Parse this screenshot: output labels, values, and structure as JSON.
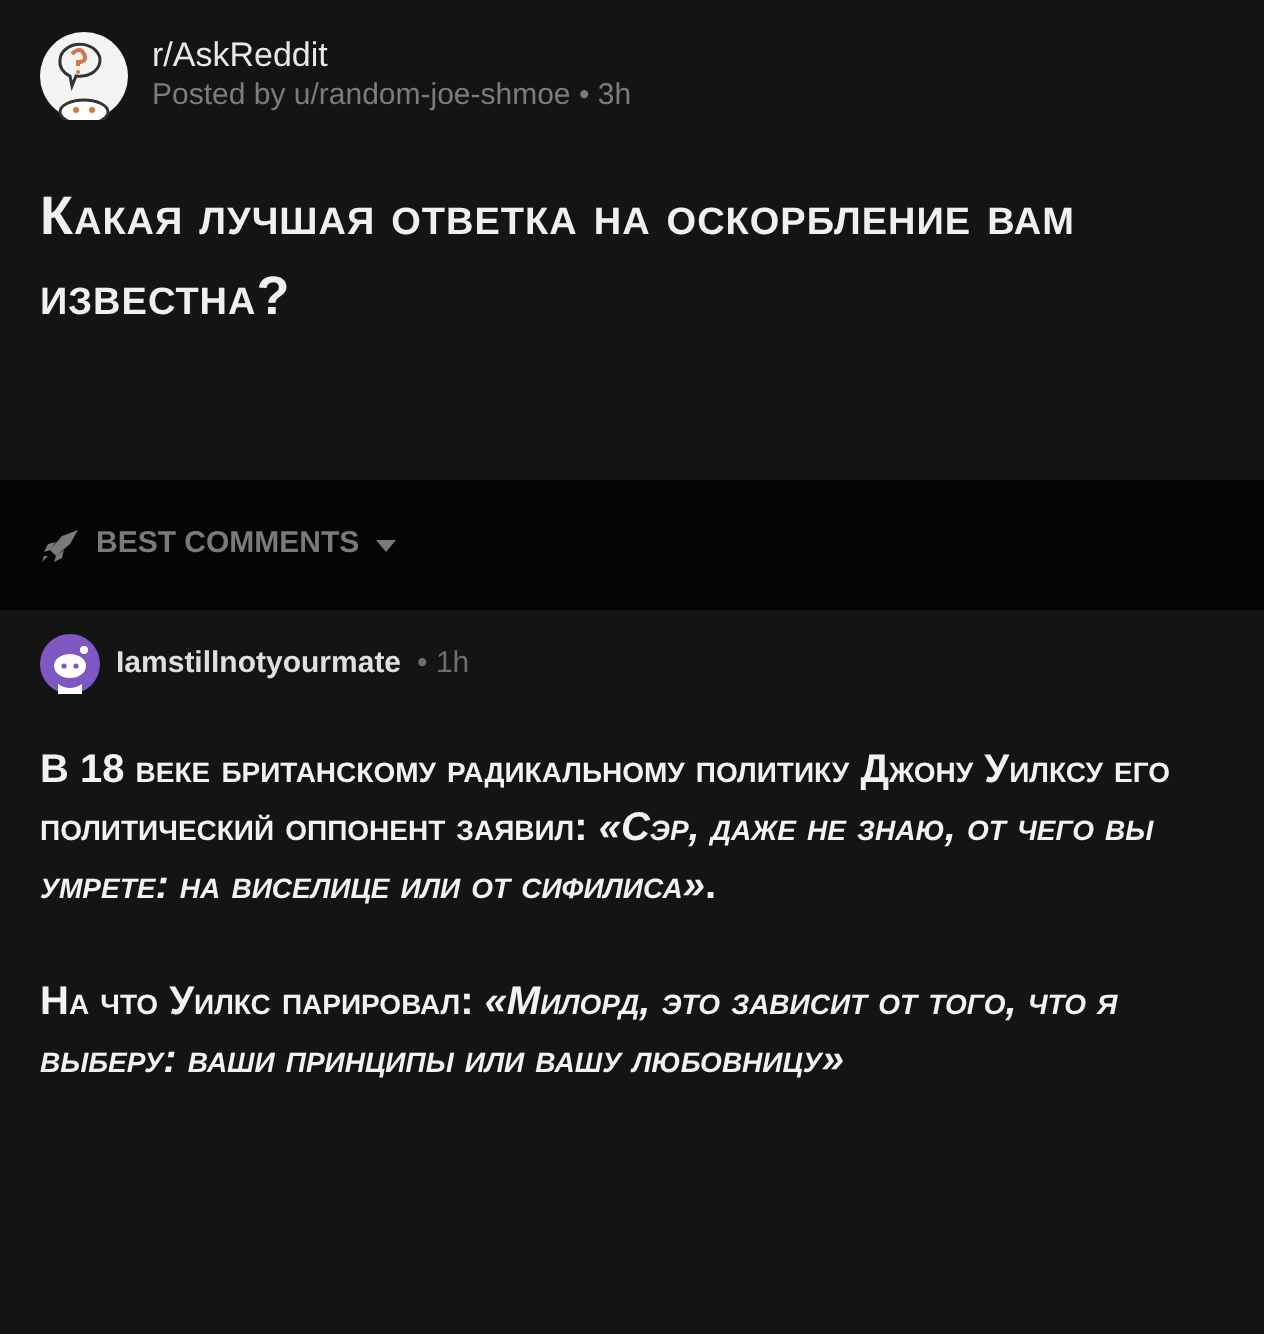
{
  "post": {
    "subreddit": "r/AskReddit",
    "meta": "Posted by u/random-joe-shmoe • 3h",
    "title": "Какая лучшая ответка на оскорбление вам известна?"
  },
  "sort": {
    "label": "BEST COMMENTS"
  },
  "comment": {
    "author": "Iamstillnotyourmate",
    "time": "• 1h",
    "paragraphs": [
      "В 18 веке британскому радикальному политику Джону Уилксу его политический оппонент заявил: *«Сэр, даже не знаю, от чего вы умрете: на виселице или от сифилиса»*.",
      "На что Уилкс парировал: *«Милорд, это зависит от того, что я выберу: ваши принципы или вашу любовницу»*"
    ]
  }
}
